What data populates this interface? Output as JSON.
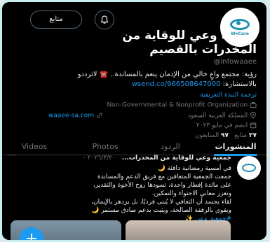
{
  "header": {
    "follow_label": "متابع",
    "avatar_brand": "WeCare"
  },
  "profile": {
    "name_line1": "جمعية وعي للوقاية من",
    "name_line2": "المخدرات بالقصيم",
    "handle": "@infowaaee",
    "bio_line1": "رؤية: مجتمع واعٍ خالي من الإدمان ينعم بالمساندة.. ☎️ لاترددو",
    "bio_line2_prefix": "بالاستشارة: ",
    "bio_line2_link": "wsend.co/966508647000",
    "pinned_link": "ترجمة النبذة التعريفية",
    "category": "Non-Governmental & Nonprofit Organization",
    "location": "المملكة العربية السعود",
    "website": "waaee-sa.com",
    "joined": "انضم في مايو ٢٠٢٣",
    "following_count": "٣٧",
    "following_label": "متابع",
    "followers_count": "٩٧",
    "followers_label": "المتابعون"
  },
  "tabs": {
    "posts": "المنشورات",
    "replies": "الردود",
    "photos": "Photos",
    "videos": "Videos"
  },
  "post": {
    "author": "جمعية وعي للوقاية من المخدرات...",
    "date": "٢٠٢٦/٣/٢٠ ·",
    "line1": "في أمسية رمضانية دافئة 🌙",
    "line2": "جمعت الجمعية المتعافين مع فريق الدعم والمساندة",
    "line3": "على مائدة إفطار واحدة، تسودها روح الأخوة والتقدير،",
    "line4": "وتعزز معاني الاحتواء والتمكين.",
    "line5": "لقاء يجسد أن التعافي لا يُبنى فرديًا، بل يزدهر بالإيمان،",
    "line6": "ويقوى بالرفقة الصالحة، ويثبت بدعم صادق مستمر 🌙",
    "hashtag": "#جمعية_وعي ✨"
  },
  "fab_label": "+"
}
